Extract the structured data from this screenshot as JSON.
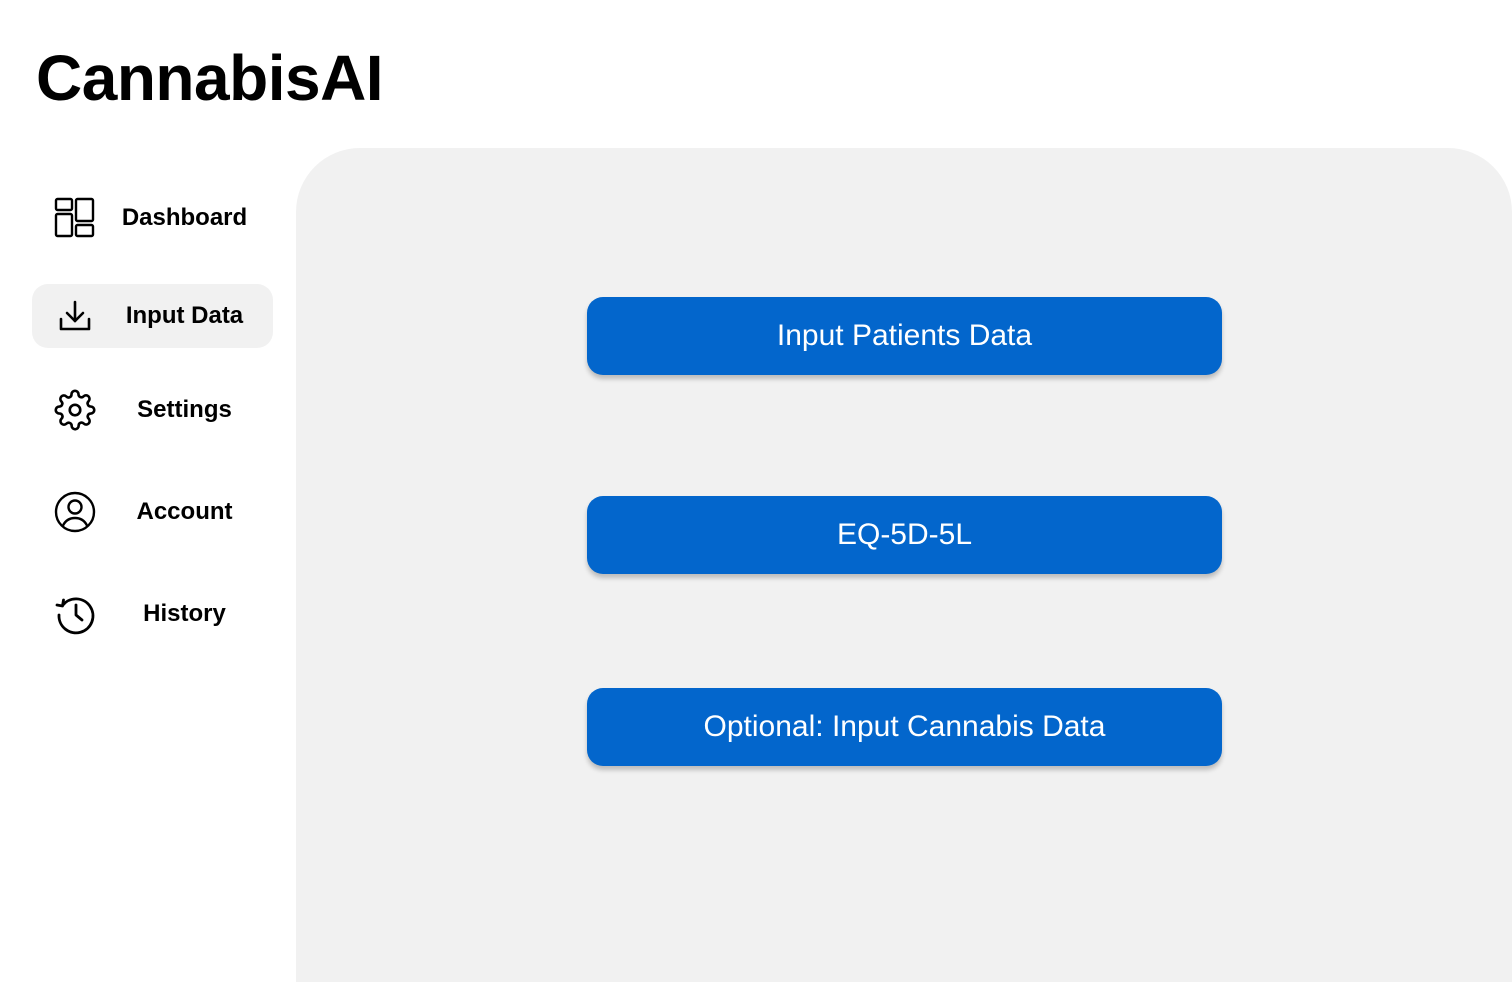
{
  "app": {
    "title": "CannabisAI"
  },
  "sidebar": {
    "items": [
      {
        "label": "Dashboard",
        "icon": "dashboard-icon",
        "active": false
      },
      {
        "label": "Input Data",
        "icon": "download-icon",
        "active": true
      },
      {
        "label": "Settings",
        "icon": "gear-icon",
        "active": false
      },
      {
        "label": "Account",
        "icon": "user-circle-icon",
        "active": false
      },
      {
        "label": "History",
        "icon": "history-icon",
        "active": false
      }
    ]
  },
  "main": {
    "buttons": [
      {
        "label": "Input Patients Data"
      },
      {
        "label": "EQ-5D-5L"
      },
      {
        "label": "Optional: Input Cannabis Data"
      }
    ]
  },
  "colors": {
    "accent": "#0366cc",
    "panel_background": "#f1f1f1",
    "active_nav_background": "#f1f1f1",
    "text": "#000000",
    "button_text": "#ffffff"
  }
}
